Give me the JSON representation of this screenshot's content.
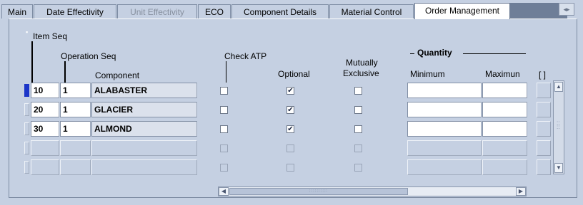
{
  "tabs": [
    {
      "label": "Main",
      "state": "normal"
    },
    {
      "label": "Date Effectivity",
      "state": "normal"
    },
    {
      "label": "Unit Effectivity",
      "state": "disabled"
    },
    {
      "label": "ECO",
      "state": "normal"
    },
    {
      "label": "Component Details",
      "state": "normal"
    },
    {
      "label": "Material Control",
      "state": "normal"
    },
    {
      "label": "Order Management",
      "state": "active"
    }
  ],
  "tab_scroll_icon": "◂▸",
  "headers": {
    "item_seq": "Item Seq",
    "operation_seq": "Operation Seq",
    "component": "Component",
    "check_atp": "Check ATP",
    "optional": "Optional",
    "mutually_line1": "Mutually",
    "mutually_line2": "Exclusive",
    "quantity": "Quantity",
    "minimum": "Minimum",
    "maximum": "Maximun",
    "extra": "[ ]"
  },
  "rows": [
    {
      "item_seq": "10",
      "op_seq": "1",
      "component": "ALABASTER",
      "check_atp": false,
      "optional": true,
      "mutually": false,
      "minimum": "",
      "maximum": "",
      "current": true
    },
    {
      "item_seq": "20",
      "op_seq": "1",
      "component": "GLACIER",
      "check_atp": false,
      "optional": true,
      "mutually": false,
      "minimum": "",
      "maximum": "",
      "current": false
    },
    {
      "item_seq": "30",
      "op_seq": "1",
      "component": "ALMOND",
      "check_atp": false,
      "optional": true,
      "mutually": false,
      "minimum": "",
      "maximum": "",
      "current": false
    },
    {
      "item_seq": "",
      "op_seq": "",
      "component": "",
      "check_atp": false,
      "optional": false,
      "mutually": false,
      "minimum": "",
      "maximum": "",
      "current": false
    },
    {
      "item_seq": "",
      "op_seq": "",
      "component": "",
      "check_atp": false,
      "optional": false,
      "mutually": false,
      "minimum": "",
      "maximum": "",
      "current": false
    }
  ],
  "checkmark": "✔",
  "icons": {
    "scroll_up": "▲",
    "scroll_down": "▼",
    "scroll_left": "◀",
    "scroll_right": "▶",
    "thumb_grip": "::::::::::"
  },
  "colors": {
    "background": "#c5d0e2",
    "current_record": "#1b35c8",
    "active_tab": "#ffffff"
  }
}
